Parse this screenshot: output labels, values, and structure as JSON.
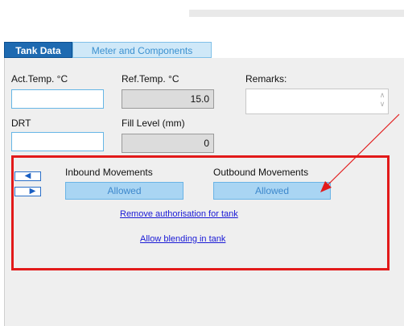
{
  "tabs": [
    {
      "label": "Tank Data",
      "active": true
    },
    {
      "label": "Meter and Components",
      "active": false
    }
  ],
  "fields": {
    "act_temp": {
      "label": "Act.Temp. °C",
      "value": ""
    },
    "ref_temp": {
      "label": "Ref.Temp. °C",
      "value": "15.0"
    },
    "remarks": {
      "label": "Remarks:",
      "value": ""
    },
    "drt": {
      "label": "DRT",
      "value": ""
    },
    "fill_level": {
      "label": "Fill Level (mm)",
      "value": "0"
    }
  },
  "movements": {
    "nav_left_icon": "arrow-left-icon",
    "nav_right_icon": "arrow-right-icon",
    "inbound_label": "Inbound Movements",
    "inbound_status": "Allowed",
    "outbound_label": "Outbound Movements",
    "outbound_status": "Allowed",
    "remove_authorisation_link": "Remove authorisation for tank",
    "allow_blending_link": "Allow blending in tank"
  },
  "colors": {
    "active_tab": "#1e6ab1",
    "highlight_box": "#e21a1a",
    "status_button": "#a9d5f3",
    "link": "#1a1ad6"
  }
}
